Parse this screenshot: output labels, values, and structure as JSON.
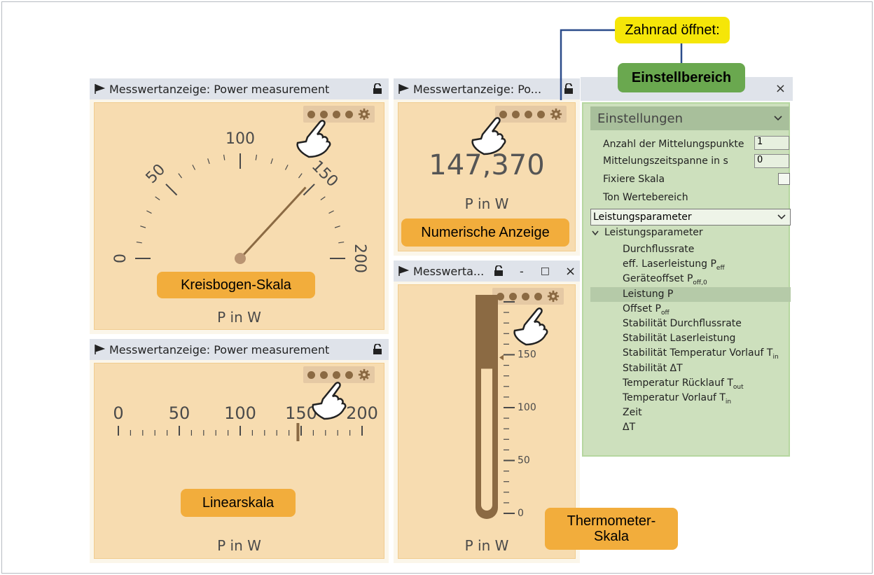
{
  "windows": {
    "arc": {
      "title": "Messwertanzeige: Power measurement",
      "unit_label": "P in W",
      "callout": "Kreisbogen-Skala",
      "ticks": [
        {
          "v": "0"
        },
        {
          "v": "50"
        },
        {
          "v": "100"
        },
        {
          "v": "150"
        },
        {
          "v": "200"
        }
      ],
      "value": 147.37,
      "max": 200
    },
    "numeric": {
      "title": "Messwertanzeige: Po...",
      "value_text": "147,370",
      "unit_label": "P in W",
      "callout": "Numerische Anzeige"
    },
    "linear": {
      "title": "Messwertanzeige: Power measurement",
      "unit_label": "P in W",
      "callout": "Linearskala",
      "ticks": [
        "0",
        "50",
        "100",
        "150",
        "200"
      ],
      "value": 147.37,
      "max": 200
    },
    "thermo": {
      "title": "Messwerta...",
      "unit_label": "P in W",
      "callout_line1": "Thermometer-",
      "callout_line2": "Skala",
      "ticks": [
        "0",
        "50",
        "100",
        "150"
      ],
      "value": 147.37,
      "max": 200,
      "buttons": {
        "minimize": "-",
        "maximize": "□",
        "close": "×"
      }
    }
  },
  "annotation": {
    "gear_opens": "Zahnrad öffnet:",
    "settings_area": "Einstellbereich"
  },
  "settings": {
    "close": "×",
    "section": "Einstellungen",
    "rows": {
      "avg_points": {
        "label": "Anzahl der Mittelungspunkte",
        "value": "1"
      },
      "avg_time": {
        "label": "Mittelungszeitspanne in s",
        "value": "0"
      },
      "fix_scale": {
        "label": "Fixiere Skala",
        "checked": false
      },
      "tone": {
        "label": "Ton Wertebereich"
      }
    },
    "select_value": "Leistungsparameter",
    "tree_root": "Leistungsparameter",
    "tree": [
      {
        "main": "Durchflussrate",
        "sub": ""
      },
      {
        "main": "eff. Laserleistung P",
        "sub": "eff"
      },
      {
        "main": "Geräteoffset P",
        "sub": "off,0"
      },
      {
        "main": "Leistung P",
        "sub": ""
      },
      {
        "main": "Offset P",
        "sub": "off"
      },
      {
        "main": "Stabilität Durchflussrate",
        "sub": ""
      },
      {
        "main": "Stabilität Laserleistung",
        "sub": ""
      },
      {
        "main": "Stabilität Temperatur Vorlauf T",
        "sub": "in"
      },
      {
        "main": "Stabilität ΔT",
        "sub": ""
      },
      {
        "main": "Temperatur Rücklauf T",
        "sub": "out"
      },
      {
        "main": "Temperatur Vorlauf T",
        "sub": "in"
      },
      {
        "main": "Zeit",
        "sub": ""
      },
      {
        "main": "ΔT",
        "sub": ""
      }
    ],
    "selected_index": 3
  },
  "colors": {
    "panel": "#f7dcb0",
    "needle": "#8b6a43",
    "callout": "#f2ad3c",
    "yellow": "#f5e608",
    "green": "#6aa84f",
    "settings_bg": "#cde0bd"
  }
}
